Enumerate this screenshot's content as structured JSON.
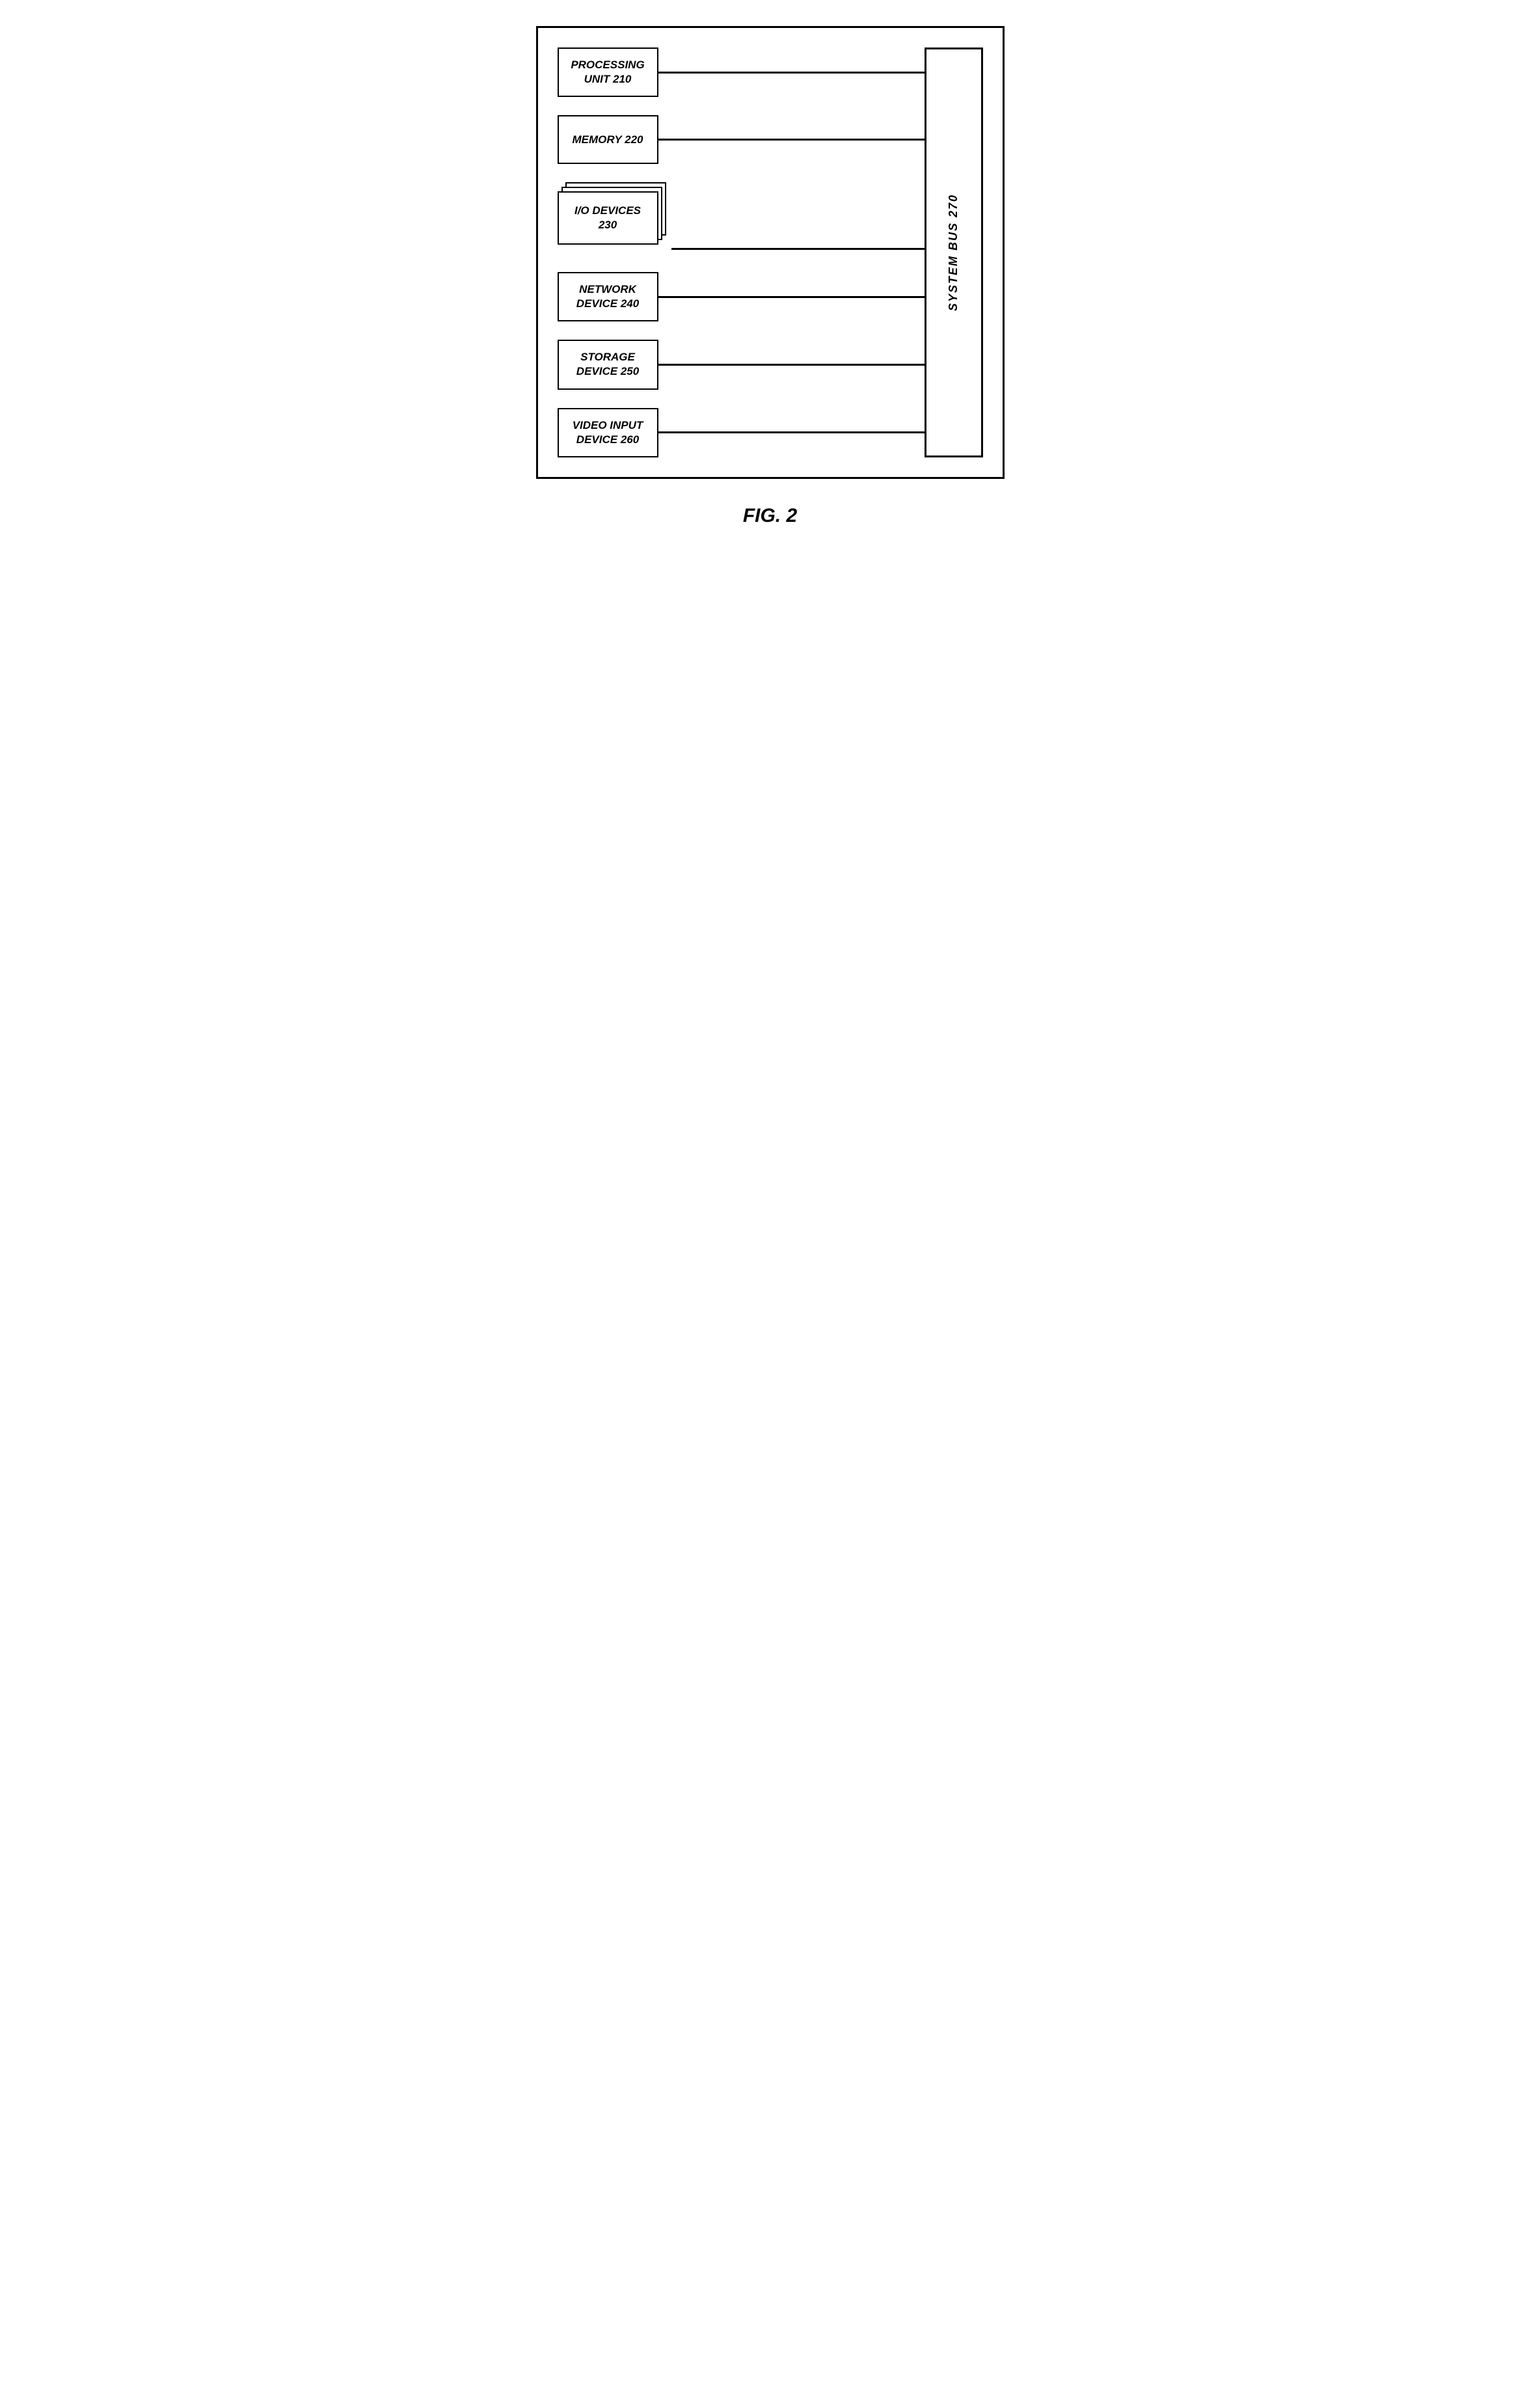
{
  "diagram": {
    "outer_border": true,
    "components": [
      {
        "id": "processing-unit",
        "label": "PROCESSING\nUNIT 210",
        "type": "single"
      },
      {
        "id": "memory",
        "label": "MEMORY 220",
        "type": "single"
      },
      {
        "id": "io-devices",
        "label": "I/O DEVICES\n230",
        "type": "stacked"
      },
      {
        "id": "network-device",
        "label": "NETWORK\nDEVICE 240",
        "type": "single"
      },
      {
        "id": "storage-device",
        "label": "STORAGE\nDEVICE 250",
        "type": "single"
      },
      {
        "id": "video-input-device",
        "label": "VIDEO INPUT\nDEVICE 260",
        "type": "single"
      }
    ],
    "system_bus": {
      "label": "SYSTEM BUS 270"
    }
  },
  "figure": {
    "label": "FIG. 2"
  }
}
